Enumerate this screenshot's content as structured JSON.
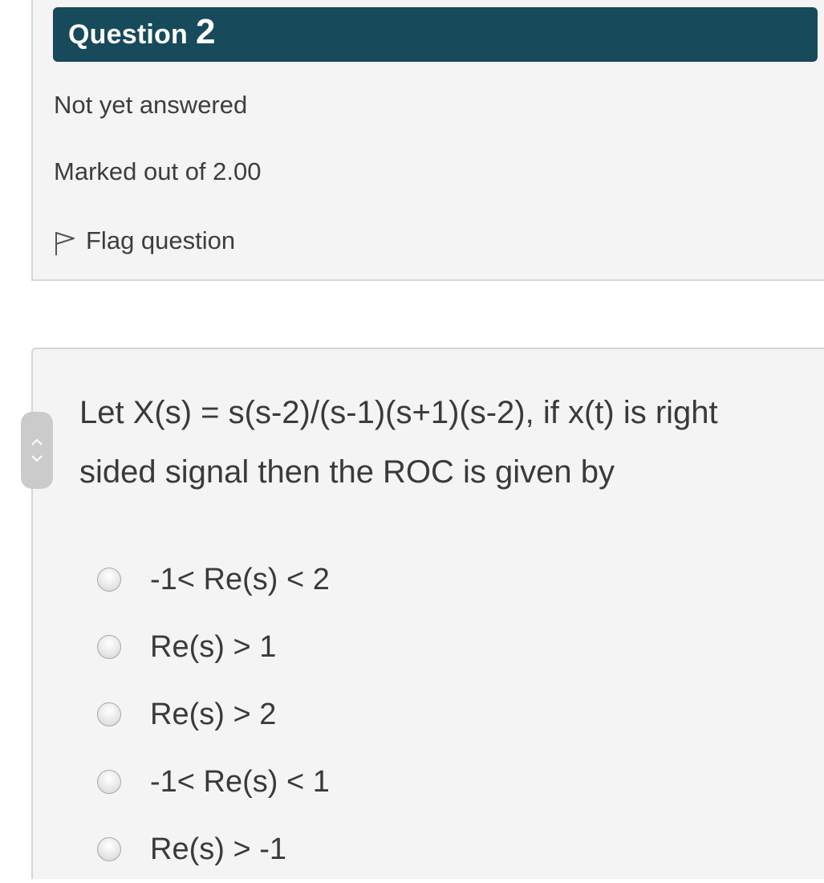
{
  "question": {
    "label": "Question",
    "number": "2",
    "status": "Not yet answered",
    "marks": "Marked out of 2.00",
    "flag_label": "Flag question",
    "text": "Let X(s) = s(s-2)/(s-1)(s+1)(s-2), if x(t) is right sided signal then the ROC is given by"
  },
  "answers": [
    {
      "label": "-1< Re(s) < 2",
      "selected": false
    },
    {
      "label": "Re(s) > 1",
      "selected": false
    },
    {
      "label": "Re(s) > 2",
      "selected": false
    },
    {
      "label": "-1< Re(s) < 1",
      "selected": false
    },
    {
      "label": "Re(s) > -1",
      "selected": false
    }
  ],
  "colors": {
    "header_bg": "#174a5a",
    "panel_bg": "#f4f4f4",
    "border": "#d3d7dc"
  },
  "icons": {
    "flag": "flag-outline-icon",
    "scroll_up": "chevron-up-icon",
    "scroll_down": "chevron-down-icon"
  }
}
